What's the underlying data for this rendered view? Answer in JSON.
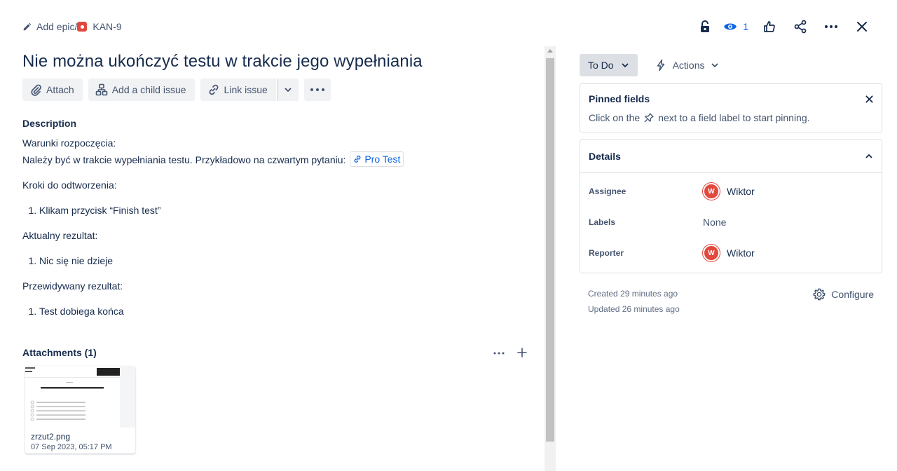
{
  "breadcrumb": {
    "add_epic": "Add epic",
    "separator": "/",
    "issue_key": "KAN-9"
  },
  "top_actions": {
    "watchers_count": "1"
  },
  "issue": {
    "title": "Nie można ukończyć testu w trakcie jego wypełniania"
  },
  "toolbar": {
    "attach": "Attach",
    "add_child": "Add a child issue",
    "link_issue": "Link issue"
  },
  "description": {
    "heading": "Description",
    "line1": "Warunki rozpoczęcia:",
    "line2": "Należy być w trakcie wypełniania testu. Przykładowo na czwartym pytaniu:",
    "link": "Pro Test",
    "steps_heading": "Kroki do odtworzenia:",
    "steps": [
      "Klikam przycisk “Finish test”"
    ],
    "actual_heading": "Aktualny rezultat:",
    "actual": [
      "Nic się nie dzieje"
    ],
    "expected_heading": "Przewidywany rezultat:",
    "expected": [
      "Test dobiega końca"
    ]
  },
  "attachments": {
    "heading": "Attachments (1)",
    "files": [
      {
        "name": "zrzut2.png",
        "date": "07 Sep 2023, 05:17 PM"
      }
    ]
  },
  "sidebar": {
    "status": "To Do",
    "actions": "Actions",
    "pinned": {
      "title": "Pinned fields",
      "hint_before": "Click on the",
      "hint_after": "next to a field label to start pinning."
    },
    "details": {
      "title": "Details",
      "rows": [
        {
          "label": "Assignee",
          "value": "Wiktor",
          "initial": "W"
        },
        {
          "label": "Labels",
          "value": "None"
        },
        {
          "label": "Reporter",
          "value": "Wiktor",
          "initial": "W"
        }
      ]
    },
    "created": "Created 29 minutes ago",
    "updated": "Updated 26 minutes ago",
    "configure": "Configure"
  },
  "colors": {
    "accent": "#0c66e4",
    "bug": "#e2483d",
    "avatar": "#e2483d"
  }
}
